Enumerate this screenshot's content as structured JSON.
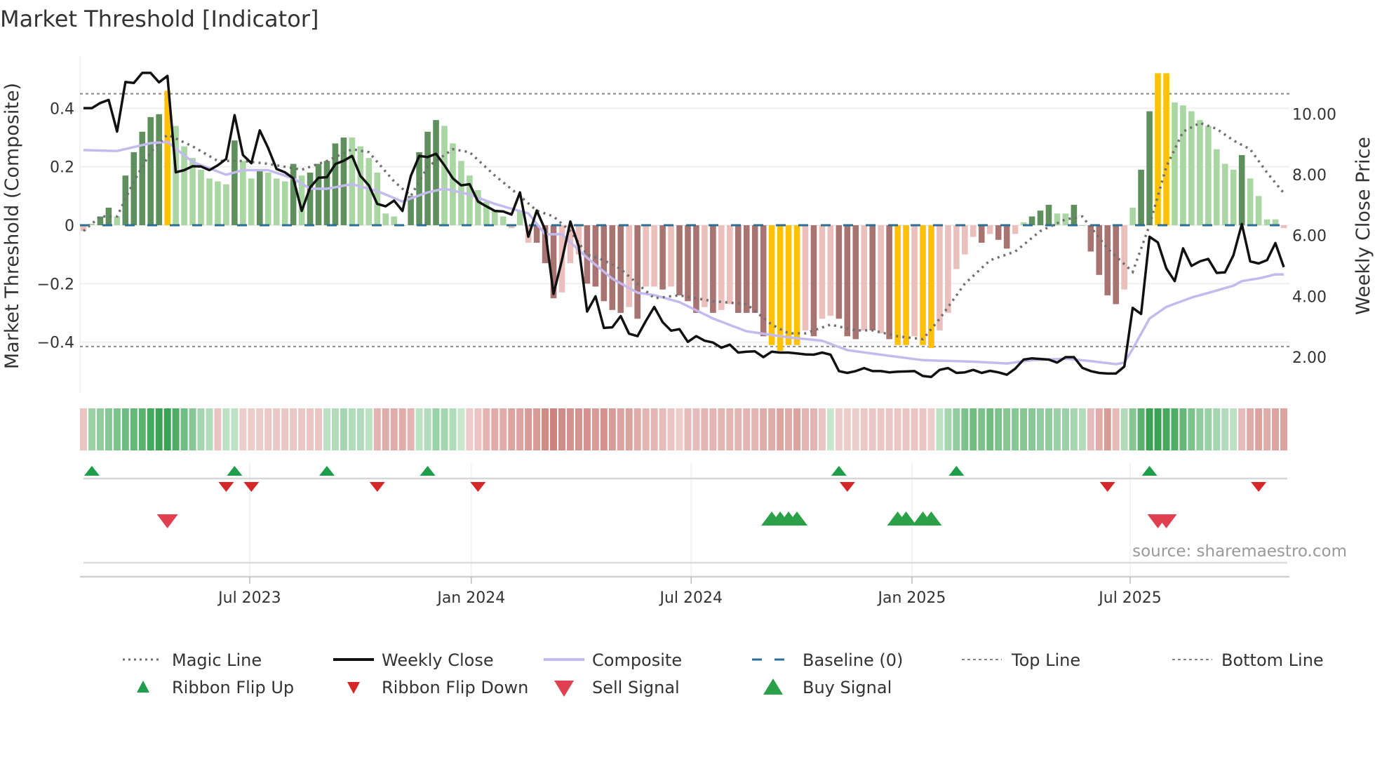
{
  "chart_data": {
    "type": "bar",
    "title": "Market Threshold [Indicator]",
    "ylabel": "Market Threshold (Composite)",
    "y2label": "Weekly Close Price",
    "source": "source: sharemaestro.com",
    "ylim": [
      -0.58,
      0.58
    ],
    "y2lim": [
      0.8,
      12.2
    ],
    "yticks": [
      {
        "v": 0.4,
        "label": "0.4"
      },
      {
        "v": 0.2,
        "label": "0.2"
      },
      {
        "v": 0,
        "label": "0"
      },
      {
        "v": -0.2,
        "label": "−0.2"
      },
      {
        "v": -0.4,
        "label": "−0.4"
      }
    ],
    "y2ticks": [
      {
        "v": 10,
        "label": "10.00"
      },
      {
        "v": 8,
        "label": "8.00"
      },
      {
        "v": 6,
        "label": "6.00"
      },
      {
        "v": 4,
        "label": "4.00"
      },
      {
        "v": 2,
        "label": "2.00"
      }
    ],
    "xticks": [
      {
        "week": 19.8,
        "label": "Jul 2023"
      },
      {
        "week": 46.2,
        "label": "Jan 2024"
      },
      {
        "week": 72.4,
        "label": "Jul 2024"
      },
      {
        "week": 98.7,
        "label": "Jan 2025"
      },
      {
        "week": 124.7,
        "label": "Jul 2025"
      }
    ],
    "top_line": 0.45,
    "bottom_line": -0.415,
    "baseline": 0,
    "colors": {
      "dark_green": "#5f8f5c",
      "light_green": "#a9d6a2",
      "dark_red": "#a87471",
      "light_red": "#ebbfbb",
      "extreme": "#ffc107",
      "close": "#111111",
      "composite": "#c4baee",
      "magic": "#707070",
      "baseline": "#2a6f97",
      "ribbon_up": "#2e9e4a",
      "ribbon_down": "#c97a76",
      "flip_up": "#1e9e4a",
      "flip_down": "#d62728",
      "sell": "#e04050",
      "buy": "#2ca048"
    },
    "bar_states_legend": {
      "G": "strong positive",
      "g": "weak positive",
      "R": "strong negative",
      "r": "weak negative",
      "Y": "extreme"
    },
    "bars": [
      -0.02,
      0.005,
      0.03,
      0.06,
      0.03,
      0.17,
      0.25,
      0.32,
      0.37,
      0.38,
      0.46,
      0.34,
      0.27,
      0.23,
      0.19,
      0.16,
      0.15,
      0.14,
      0.29,
      0.22,
      0.16,
      0.19,
      0.18,
      0.16,
      0.15,
      0.21,
      0.17,
      0.18,
      0.21,
      0.22,
      0.28,
      0.3,
      0.3,
      0.27,
      0.23,
      0.18,
      0.04,
      0.03,
      0.0,
      0.1,
      0.25,
      0.32,
      0.36,
      0.34,
      0.28,
      0.22,
      0.17,
      0.12,
      0.08,
      0.05,
      0.03,
      -0.01,
      0.05,
      -0.06,
      -0.06,
      -0.13,
      -0.25,
      -0.23,
      -0.13,
      -0.1,
      -0.2,
      -0.21,
      -0.26,
      -0.29,
      -0.3,
      -0.28,
      -0.32,
      -0.21,
      -0.21,
      -0.22,
      -0.21,
      -0.24,
      -0.26,
      -0.3,
      -0.28,
      -0.3,
      -0.29,
      -0.27,
      -0.3,
      -0.3,
      -0.3,
      -0.38,
      -0.41,
      -0.43,
      -0.41,
      -0.41,
      -0.36,
      -0.38,
      -0.32,
      -0.31,
      -0.32,
      -0.38,
      -0.39,
      -0.36,
      -0.36,
      -0.37,
      -0.39,
      -0.41,
      -0.41,
      -0.38,
      -0.41,
      -0.42,
      -0.36,
      -0.3,
      -0.15,
      -0.1,
      -0.04,
      -0.06,
      -0.03,
      -0.05,
      -0.08,
      -0.03,
      0.01,
      0.03,
      0.05,
      0.07,
      0.04,
      0.04,
      0.07,
      0.0,
      -0.09,
      -0.17,
      -0.24,
      -0.27,
      -0.22,
      0.06,
      0.19,
      0.39,
      0.52,
      0.52,
      0.42,
      0.41,
      0.39,
      0.36,
      0.34,
      0.26,
      0.21,
      0.19,
      0.24,
      0.16,
      0.1,
      0.02,
      0.02,
      -0.01
    ],
    "bar_states": "rgGGgGGGGGYgggggggGggGgggGgGGGGGgggggggGGGGggggggggrgrRRRrrrRRRRRrRrrRrR",
    "bar_states_2": "RRrRrrRRRRYYYYrRrrRRRrRrRYYrYYrrrrrRrRRrgGGGggGgRRRRrgGGYYggggggggGgggg",
    "weekly_close": [
      10.19,
      10.19,
      10.36,
      10.46,
      9.42,
      11.05,
      11.02,
      11.35,
      11.35,
      11.04,
      11.25,
      8.08,
      8.15,
      8.28,
      8.27,
      8.15,
      8.31,
      8.52,
      9.96,
      8.65,
      8.38,
      9.46,
      8.88,
      8.19,
      8.08,
      7.88,
      6.81,
      7.58,
      7.9,
      7.92,
      8.35,
      8.46,
      8.62,
      7.96,
      7.65,
      7.04,
      6.96,
      7.15,
      6.81,
      7.96,
      8.62,
      8.58,
      8.69,
      8.31,
      7.88,
      7.65,
      7.69,
      7.12,
      6.96,
      6.81,
      6.79,
      6.69,
      7.42,
      5.96,
      6.82,
      6.19,
      4.08,
      5.19,
      6.46,
      5.65,
      3.5,
      4.0,
      2.96,
      2.98,
      3.35,
      2.77,
      2.69,
      3.19,
      3.65,
      3.15,
      2.87,
      2.92,
      2.5,
      2.69,
      2.54,
      2.48,
      2.31,
      2.41,
      2.15,
      2.18,
      2.19,
      2.0,
      2.18,
      2.15,
      2.15,
      2.12,
      2.09,
      2.08,
      2.15,
      2.08,
      1.54,
      1.48,
      1.54,
      1.64,
      1.54,
      1.54,
      1.5,
      1.52,
      1.53,
      1.54,
      1.38,
      1.35,
      1.58,
      1.64,
      1.48,
      1.5,
      1.58,
      1.48,
      1.55,
      1.5,
      1.42,
      1.62,
      1.92,
      1.96,
      1.94,
      1.92,
      1.82,
      2.0,
      2.0,
      1.65,
      1.54,
      1.48,
      1.46,
      1.46,
      1.69,
      3.62,
      3.42,
      5.96,
      5.77,
      4.92,
      4.5,
      5.58,
      5.0,
      5.15,
      5.23,
      4.77,
      4.79,
      5.35,
      6.38,
      5.15,
      5.08,
      5.19,
      5.75,
      4.96
    ],
    "composite_line": [
      [
        0,
        8.81
      ],
      [
        4,
        8.78
      ],
      [
        8,
        9.04
      ],
      [
        10,
        9.08
      ],
      [
        13,
        8.42
      ],
      [
        17,
        8.0
      ],
      [
        19,
        8.15
      ],
      [
        22,
        8.15
      ],
      [
        25,
        7.88
      ],
      [
        27,
        7.54
      ],
      [
        29,
        7.54
      ],
      [
        32,
        7.69
      ],
      [
        35,
        7.46
      ],
      [
        38,
        7.12
      ],
      [
        41,
        7.42
      ],
      [
        43,
        7.54
      ],
      [
        46,
        7.35
      ],
      [
        49,
        7.04
      ],
      [
        51,
        6.88
      ],
      [
        53,
        6.73
      ],
      [
        55,
        6.04
      ],
      [
        57,
        6.04
      ],
      [
        60,
        5.27
      ],
      [
        63,
        4.58
      ],
      [
        66,
        4.12
      ],
      [
        68,
        4.04
      ],
      [
        71,
        3.81
      ],
      [
        75,
        3.27
      ],
      [
        79,
        2.85
      ],
      [
        84,
        2.65
      ],
      [
        88,
        2.54
      ],
      [
        91,
        2.23
      ],
      [
        95,
        2.08
      ],
      [
        100,
        1.9
      ],
      [
        106,
        1.85
      ],
      [
        110,
        1.79
      ],
      [
        113,
        1.9
      ],
      [
        117,
        1.95
      ],
      [
        120,
        1.87
      ],
      [
        123,
        1.77
      ],
      [
        124,
        1.82
      ],
      [
        125,
        2.27
      ],
      [
        127,
        3.27
      ],
      [
        129,
        3.65
      ],
      [
        132,
        3.96
      ],
      [
        135,
        4.19
      ],
      [
        137,
        4.35
      ],
      [
        138,
        4.5
      ],
      [
        140,
        4.59
      ],
      [
        142,
        4.72
      ],
      [
        143,
        4.72
      ]
    ],
    "magic_line": [
      [
        0,
        -0.02
      ],
      [
        2,
        0.03
      ],
      [
        4,
        0.03
      ],
      [
        6,
        0.15
      ],
      [
        8,
        0.25
      ],
      [
        10,
        0.31
      ],
      [
        13,
        0.27
      ],
      [
        16,
        0.22
      ],
      [
        19,
        0.22
      ],
      [
        22,
        0.21
      ],
      [
        26,
        0.19
      ],
      [
        29,
        0.22
      ],
      [
        32,
        0.26
      ],
      [
        34,
        0.25
      ],
      [
        37,
        0.15
      ],
      [
        39,
        0.1
      ],
      [
        41,
        0.2
      ],
      [
        44,
        0.26
      ],
      [
        46,
        0.25
      ],
      [
        49,
        0.17
      ],
      [
        52,
        0.1
      ],
      [
        54,
        0.05
      ],
      [
        56,
        0.03
      ],
      [
        58,
        -0.02
      ],
      [
        60,
        -0.1
      ],
      [
        62,
        -0.12
      ],
      [
        64,
        -0.15
      ],
      [
        66,
        -0.2
      ],
      [
        68,
        -0.25
      ],
      [
        71,
        -0.24
      ],
      [
        75,
        -0.26
      ],
      [
        79,
        -0.27
      ],
      [
        82,
        -0.34
      ],
      [
        84,
        -0.37
      ],
      [
        86,
        -0.37
      ],
      [
        89,
        -0.34
      ],
      [
        92,
        -0.36
      ],
      [
        94,
        -0.36
      ],
      [
        97,
        -0.38
      ],
      [
        100,
        -0.39
      ],
      [
        102,
        -0.32
      ],
      [
        105,
        -0.2
      ],
      [
        108,
        -0.12
      ],
      [
        111,
        -0.09
      ],
      [
        114,
        -0.02
      ],
      [
        117,
        0.02
      ],
      [
        119,
        0.03
      ],
      [
        122,
        -0.08
      ],
      [
        125,
        -0.16
      ],
      [
        127,
        0.0
      ],
      [
        129,
        0.2
      ],
      [
        131,
        0.32
      ],
      [
        133,
        0.35
      ],
      [
        135,
        0.33
      ],
      [
        137,
        0.29
      ],
      [
        139,
        0.26
      ],
      [
        141,
        0.18
      ],
      [
        143,
        0.11
      ]
    ],
    "ribbon": [
      -0.2,
      0.35,
      0.4,
      0.45,
      0.5,
      0.55,
      0.6,
      0.65,
      0.75,
      0.8,
      0.8,
      0.7,
      0.55,
      0.45,
      0.3,
      0.25,
      -0.2,
      0.2,
      0.2,
      -0.15,
      -0.15,
      -0.15,
      -0.18,
      -0.18,
      -0.18,
      -0.18,
      -0.18,
      -0.2,
      -0.2,
      0.2,
      0.25,
      0.3,
      0.25,
      0.25,
      0.2,
      -0.3,
      -0.35,
      -0.35,
      -0.35,
      -0.3,
      0.2,
      0.25,
      0.35,
      0.3,
      0.25,
      0.15,
      -0.15,
      -0.2,
      -0.3,
      -0.35,
      -0.35,
      -0.4,
      -0.4,
      -0.45,
      -0.45,
      -0.55,
      -0.6,
      -0.55,
      -0.5,
      -0.5,
      -0.5,
      -0.45,
      -0.5,
      -0.45,
      -0.4,
      -0.4,
      -0.35,
      -0.3,
      -0.3,
      -0.25,
      -0.2,
      -0.15,
      -0.25,
      -0.25,
      -0.3,
      -0.3,
      -0.3,
      -0.3,
      -0.3,
      -0.3,
      -0.3,
      -0.35,
      -0.35,
      -0.4,
      -0.35,
      -0.4,
      -0.3,
      -0.3,
      -0.2,
      0.15,
      -0.15,
      -0.15,
      -0.15,
      -0.18,
      -0.18,
      -0.18,
      -0.18,
      -0.18,
      -0.2,
      -0.2,
      -0.2,
      -0.15,
      0.2,
      0.3,
      0.4,
      0.5,
      0.55,
      0.5,
      0.55,
      0.5,
      0.45,
      0.45,
      0.45,
      0.45,
      0.4,
      0.4,
      0.35,
      0.35,
      0.3,
      0.25,
      -0.25,
      -0.35,
      -0.45,
      -0.25,
      0.25,
      0.45,
      0.65,
      0.8,
      0.8,
      0.75,
      0.7,
      0.6,
      0.5,
      0.4,
      0.35,
      0.3,
      0.25,
      0.2,
      -0.25,
      -0.35,
      -0.4,
      -0.35,
      -0.4,
      -0.4
    ],
    "ribbon_flip_up": [
      1,
      18,
      29,
      41,
      90,
      104,
      127
    ],
    "ribbon_flip_down": [
      17,
      20,
      35,
      47,
      91,
      122,
      140
    ],
    "sell_signals": [
      10,
      128,
      129
    ],
    "buy_signals": [
      82,
      83,
      84,
      85,
      97,
      98,
      100,
      101
    ]
  },
  "legend": {
    "magic": "Magic Line",
    "close": "Weekly Close",
    "composite": "Composite",
    "baseline": "Baseline (0)",
    "top": "Top Line",
    "bottom": "Bottom Line",
    "flip_up": "Ribbon Flip Up",
    "flip_down": "Ribbon Flip Down",
    "sell": "Sell Signal",
    "buy": "Buy Signal"
  }
}
